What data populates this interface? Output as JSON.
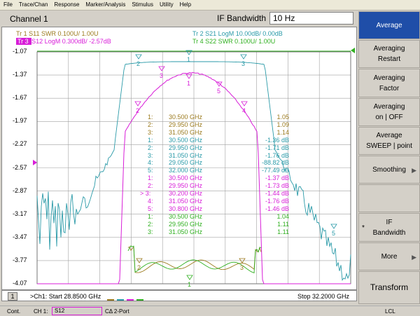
{
  "menu": [
    "File",
    "Trace/Chan",
    "Response",
    "Marker/Analysis",
    "Stimulus",
    "Utility",
    "Help"
  ],
  "channel_title": "Channel 1",
  "if_bandwidth": {
    "label": "IF Bandwidth",
    "value": "10 Hz"
  },
  "traces": [
    {
      "label": "Tr  1",
      "text": "S11 SWR 0.100U/  1.00U",
      "color": "#9b7a1e"
    },
    {
      "label": "Tr  2",
      "text": "S21 LogM 10.00dB/  0.00dB",
      "color": "#2a9aa8"
    },
    {
      "label": "Tr  3",
      "text": "S12 LogM 0.300dB/  -2.57dB",
      "color": "#d81ed8"
    },
    {
      "label": "Tr  4",
      "text": "S22 SWR 0.100U/  1.00U",
      "color": "#30b020"
    }
  ],
  "y_ticks": [
    "-1.07",
    "-1.37",
    "-1.67",
    "-1.97",
    "-2.27",
    "-2.57",
    "-2.87",
    "-3.17",
    "-3.47",
    "-3.77",
    "-4.07"
  ],
  "markers": [
    {
      "num": "1:",
      "freq": "30.500 GHz",
      "val": "1.05",
      "color": "#9b7a1e"
    },
    {
      "num": "2:",
      "freq": "29.950 GHz",
      "val": "1.09",
      "color": "#9b7a1e"
    },
    {
      "num": "3:",
      "freq": "31.050 GHz",
      "val": "1.14",
      "color": "#9b7a1e"
    },
    {
      "num": "1:",
      "freq": "30.500 GHz",
      "val": "-1.36 dB",
      "color": "#2a9aa8"
    },
    {
      "num": "2:",
      "freq": "29.950 GHz",
      "val": "-1.71 dB",
      "color": "#2a9aa8"
    },
    {
      "num": "3:",
      "freq": "31.050 GHz",
      "val": "-1.76 dB",
      "color": "#2a9aa8"
    },
    {
      "num": "4:",
      "freq": "29.050 GHz",
      "val": "-88.82 dB",
      "color": "#2a9aa8"
    },
    {
      "num": "5:",
      "freq": "32.000 GHz",
      "val": "-77.49 dB",
      "color": "#2a9aa8"
    },
    {
      "num": "1:",
      "freq": "30.500 GHz",
      "val": "-1.37 dB",
      "color": "#d81ed8"
    },
    {
      "num": "2:",
      "freq": "29.950 GHz",
      "val": "-1.73 dB",
      "color": "#d81ed8"
    },
    {
      "num": "> 3:",
      "freq": "30.200 GHz",
      "val": "-1.44 dB",
      "color": "#d81ed8"
    },
    {
      "num": "4:",
      "freq": "31.050 GHz",
      "val": "-1.76 dB",
      "color": "#d81ed8"
    },
    {
      "num": "5:",
      "freq": "30.800 GHz",
      "val": "-1.46 dB",
      "color": "#d81ed8"
    },
    {
      "num": "1:",
      "freq": "30.500 GHz",
      "val": "1.04",
      "color": "#30b020"
    },
    {
      "num": "2:",
      "freq": "29.950 GHz",
      "val": "1.11",
      "color": "#30b020"
    },
    {
      "num": "3:",
      "freq": "31.050 GHz",
      "val": "1.11",
      "color": "#30b020"
    }
  ],
  "bottom": {
    "channel_num": "1",
    "start": ">Ch1: Start  28.8500 GHz",
    "stop": "Stop  32.2000 GHz"
  },
  "status": {
    "cont": "Cont.",
    "ch": "CH 1:",
    "param": "S12",
    "port": "CΔ 2-Port",
    "lcl": "LCL"
  },
  "softkeys": [
    {
      "label": "Average",
      "active": true
    },
    {
      "label": "Averaging\nRestart"
    },
    {
      "label": "Averaging\nFactor"
    },
    {
      "label": "Averaging\non | OFF"
    },
    {
      "label": "Average\nSWEEP | point"
    },
    {
      "label": "Smoothing",
      "arrow": true
    },
    {
      "label": ""
    },
    {
      "label": "IF\nBandwidth",
      "star": true
    },
    {
      "label": "More",
      "arrow": true
    },
    {
      "label": "Transform"
    }
  ],
  "colors": {
    "tr1": "#9b7a1e",
    "tr2": "#2a9aa8",
    "tr3": "#d81ed8",
    "tr4": "#30b020",
    "softkey_active": "#1f4ea8"
  }
}
